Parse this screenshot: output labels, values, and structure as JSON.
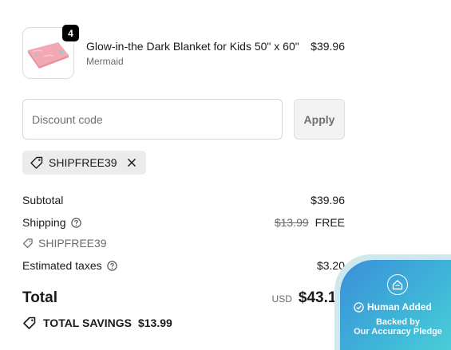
{
  "product": {
    "quantity": "4",
    "title": "Glow-in-the Dark Blanket for Kids 50\" x 60\"",
    "variant": "Mermaid",
    "price": "$39.96",
    "thumbnail_icon": "blanket-image"
  },
  "discount": {
    "placeholder": "Discount code",
    "value": "",
    "apply_label": "Apply",
    "applied_code": "SHIPFREE39"
  },
  "summary": {
    "subtotal_label": "Subtotal",
    "subtotal_value": "$39.96",
    "shipping_label": "Shipping",
    "shipping_original": "$13.99",
    "shipping_value": "FREE",
    "shipping_code": "SHIPFREE39",
    "taxes_label": "Estimated taxes",
    "taxes_value": "$3.20",
    "total_label": "Total",
    "total_currency": "USD",
    "total_value": "$43.16",
    "savings_label": "TOTAL SAVINGS",
    "savings_value": "$13.99"
  },
  "pledge_badge": {
    "title": "Human Added",
    "line1": "Backed by",
    "line2": "Our Accuracy Pledge"
  },
  "colors": {
    "badge_bg": "#000000",
    "chip_bg": "#ececec",
    "pledge_gradient_start": "#3a8fd9",
    "pledge_gradient_end": "#4fd7d8"
  }
}
